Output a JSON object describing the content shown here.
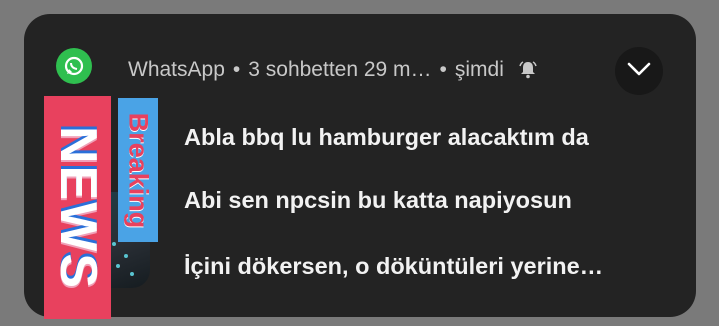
{
  "notification": {
    "app_name": "WhatsApp",
    "separator": "•",
    "summary": "3 sohbetten 29 m…",
    "time": "şimdi",
    "icons": {
      "app": "whatsapp-icon",
      "bell": "bell-icon",
      "expand": "chevron-down-icon"
    },
    "messages": [
      "Abla bbq lu hamburger alacaktım da",
      "Abi sen npcsin bu katta napiyosun",
      "İçini dökersen, o döküntüleri yerine…"
    ]
  },
  "overlay": {
    "news_text": "NEWS",
    "breaking_text": "Breaking"
  },
  "colors": {
    "card": "#232323",
    "background": "#7a7a7a",
    "whatsapp_green": "#2fbf4f",
    "news_pink": "#e8415e",
    "breaking_blue": "#4aa3e6"
  }
}
